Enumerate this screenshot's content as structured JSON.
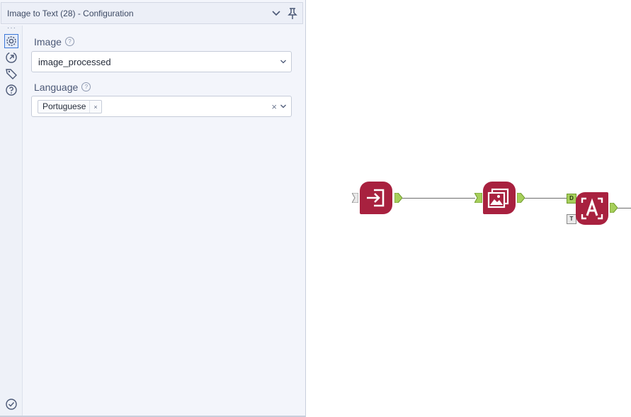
{
  "panel": {
    "title": "Image to Text (28) - Configuration",
    "header_icons": [
      "chevron-down-icon",
      "pin-icon"
    ],
    "sidebar_icons": [
      "gear-icon",
      "connection-icon",
      "tag-icon",
      "help-icon",
      "check-circle-icon"
    ]
  },
  "form": {
    "image_label": "Image",
    "image_value": "image_processed",
    "language_label": "Language",
    "language_chips": [
      "Portuguese"
    ],
    "chip_remove": "×",
    "clear": "×",
    "help": "?"
  },
  "canvas": {
    "tool_icons": [
      "input-icon",
      "image-icon",
      "ocr-icon"
    ],
    "anchor_labels": [
      "D",
      "T"
    ]
  },
  "colors": {
    "tool": "#a8213f",
    "anchor_green": "#a6cf5b",
    "panel_bg": "#f3f5fb"
  }
}
